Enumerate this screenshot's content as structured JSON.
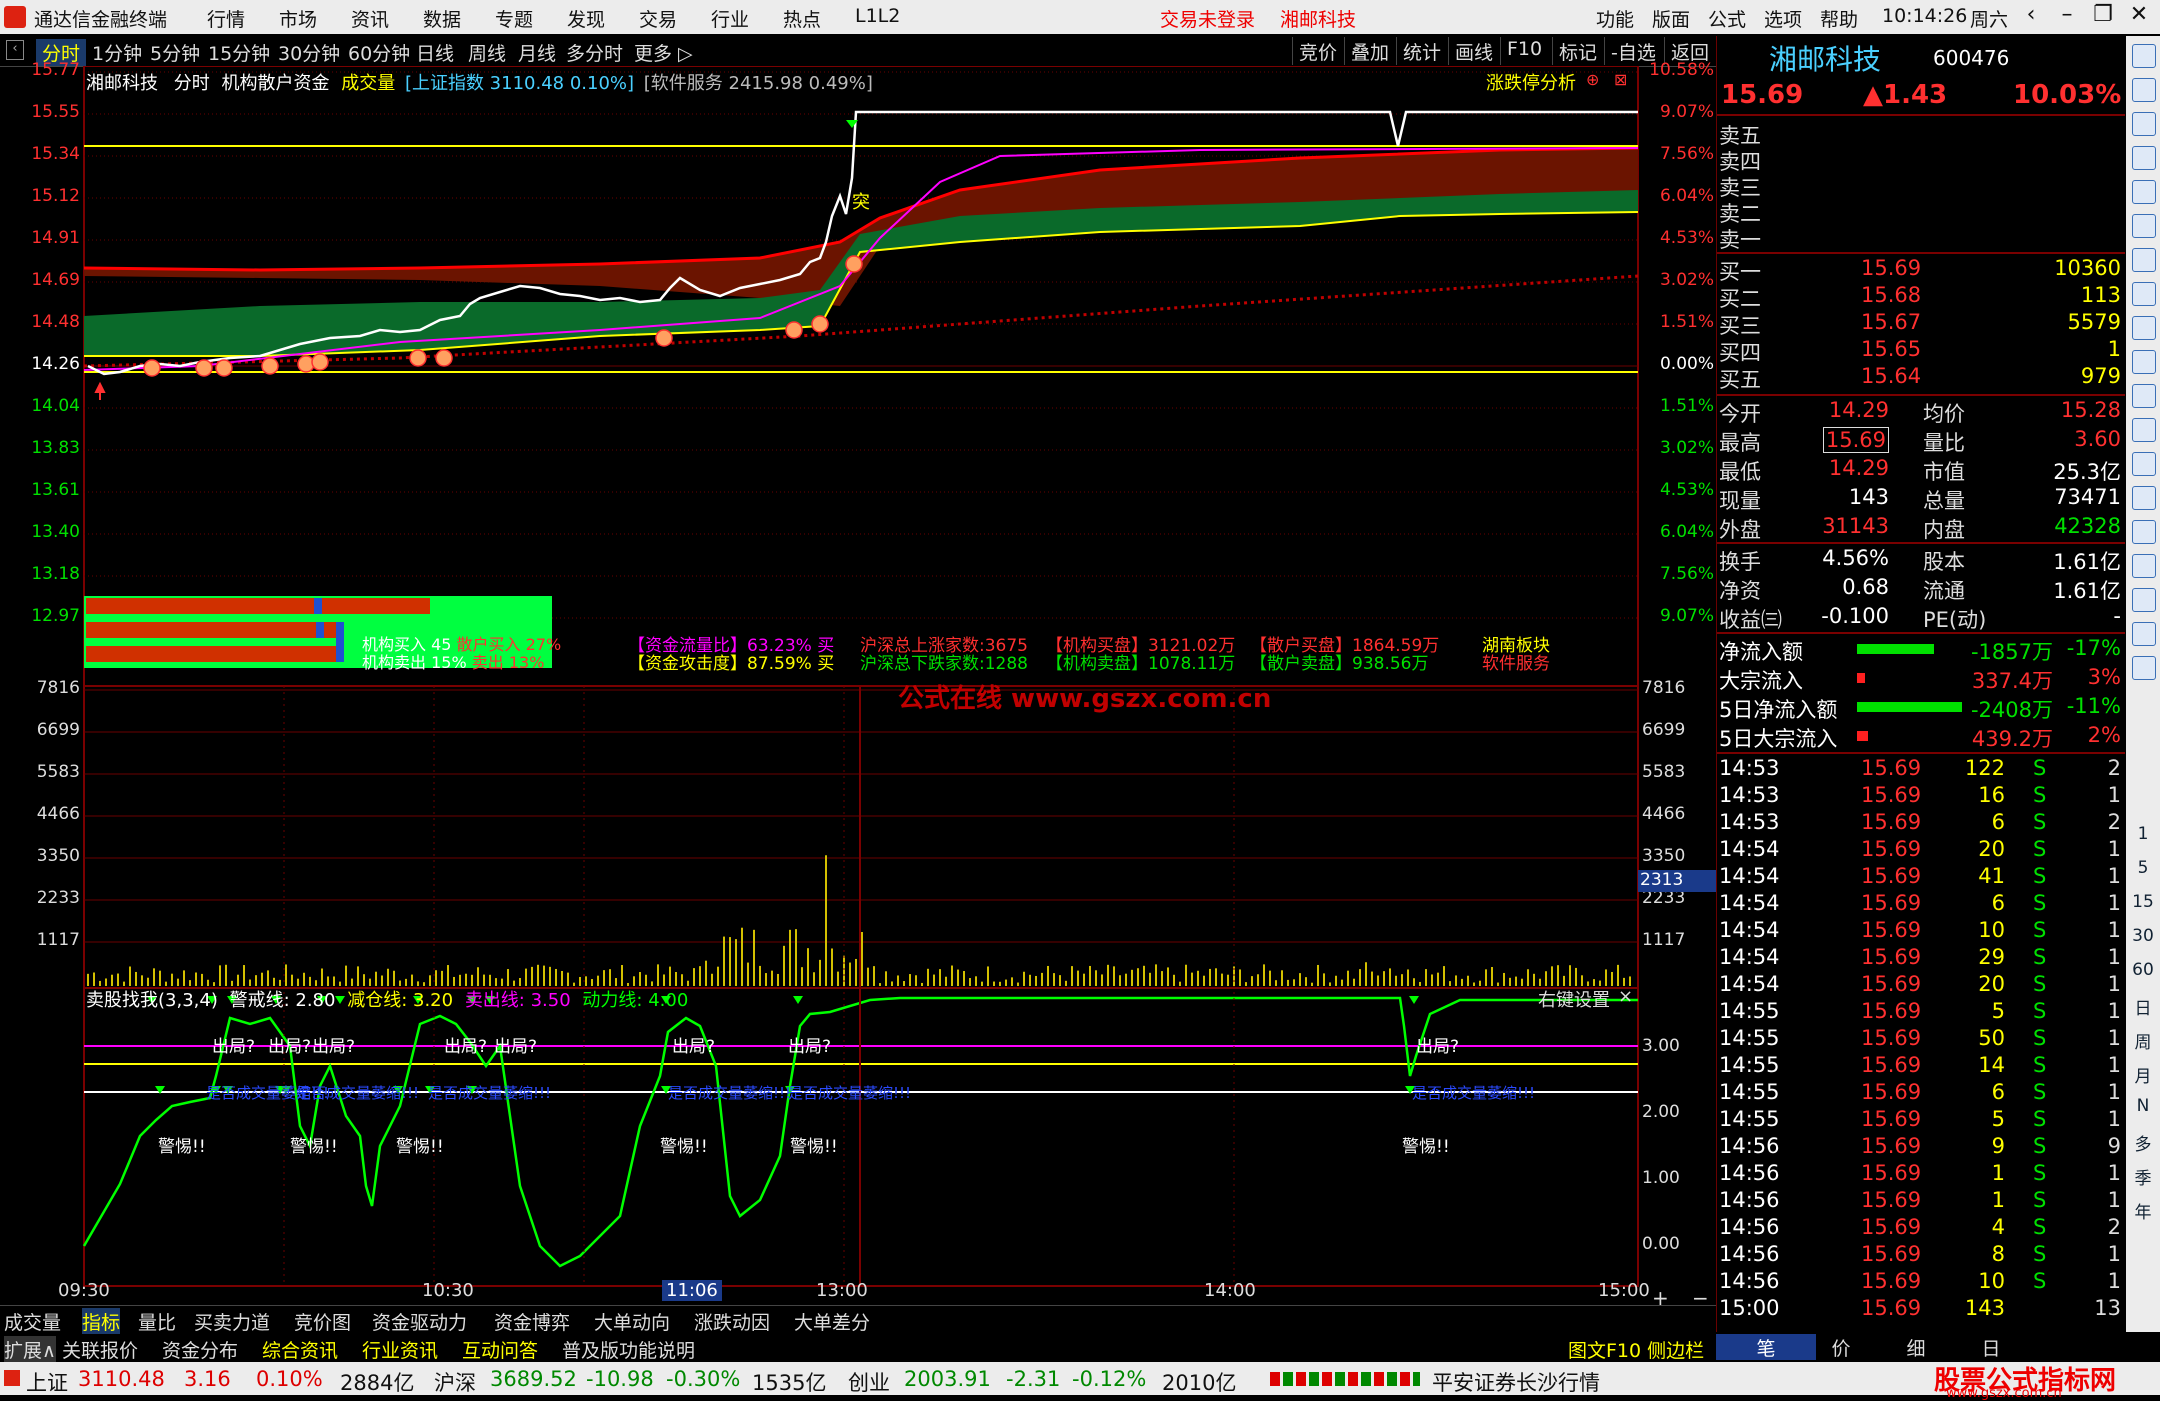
{
  "app": {
    "title": "通达信金融终端",
    "menu": [
      "行情",
      "市场",
      "资讯",
      "数据",
      "专题",
      "发现",
      "交易",
      "行业",
      "热点",
      "L1L2"
    ],
    "login_status": "交易未登录",
    "stock_name_top": "湘邮科技",
    "right_menu": [
      "功能",
      "版面",
      "公式",
      "选项",
      "帮助"
    ],
    "time": "10:14:26",
    "weekday": "周六"
  },
  "periods": {
    "items": [
      "分时",
      "1分钟",
      "5分钟",
      "15分钟",
      "30分钟",
      "60分钟",
      "日线",
      "周线",
      "月线",
      "多分时",
      "更多 ▷"
    ],
    "active": "分时",
    "right_buttons": [
      "竞价",
      "叠加",
      "统计",
      "画线",
      "F10",
      "标记",
      "-自选",
      "返回"
    ]
  },
  "chart_header": {
    "name": "湘邮科技",
    "mode": "分时",
    "indicator": "机构散户资金",
    "vol_label": "成交量",
    "index_text": "[上证指数 3110.48 0.10%]",
    "sector_text": "[软件服务 2415.98 0.49%]",
    "analysis_btn": "涨跌停分析"
  },
  "price_axis_left": [
    "15.77",
    "15.55",
    "15.34",
    "15.12",
    "14.91",
    "14.69",
    "14.48",
    "14.26",
    "14.04",
    "13.83",
    "13.61",
    "13.40",
    "13.18",
    "12.97"
  ],
  "price_axis_right": [
    "10.58%",
    "9.07%",
    "7.56%",
    "6.04%",
    "4.53%",
    "3.02%",
    "1.51%",
    "0.00%",
    "1.51%",
    "3.02%",
    "4.53%",
    "6.04%",
    "7.56%",
    "9.07%"
  ],
  "volume_axis": [
    "7816",
    "6699",
    "5583",
    "4466",
    "3350",
    "2233",
    "1117"
  ],
  "volume_current": "2313",
  "overlay_stats": {
    "inst_buy": "机构买入 45",
    "retail_buy": "散户买入 27%",
    "inst_sell": "机构卖出 15%",
    "retail_sell": "卖出 13%",
    "flow_ratio": "【资金流量比】63.23% 买",
    "attack": "【资金攻击度】87.59% 买",
    "up_count": "沪深总上涨家数:3675",
    "down_count": "沪深总下跌家数:1288",
    "inst_buy_amt": "【机构买盘】3121.02万",
    "inst_sell_amt": "【机构卖盘】1078.11万",
    "retail_buy_amt": "【散户买盘】1864.59万",
    "retail_sell_amt": "【散户卖盘】938.56万",
    "sector1": "湖南板块",
    "sector2": "软件服务"
  },
  "watermark": "公式在线  www.gszx.com.cn",
  "sell_label": "突",
  "indicator_panel": {
    "name": "卖股找我(3,3,4)",
    "warn_line": "警戒线: 2.80",
    "reduce_line": "减仓线: 3.20",
    "sell_line": "卖出线: 3.50",
    "power_line": "动力线: 4.00",
    "settings": "右键设置",
    "axis": [
      "3.00",
      "2.00",
      "1.00",
      "0.00"
    ],
    "exit_text": "出局?",
    "alert_text": "警惕!!",
    "blue_text": "是否成交量萎缩!!!"
  },
  "time_axis": [
    "09:30",
    "10:30",
    "11:06",
    "13:00",
    "14:00",
    "15:00"
  ],
  "tabs_bottom": [
    "成交量",
    "指标",
    "量比",
    "买卖力道",
    "竞价图",
    "资金驱动力",
    "资金博弈",
    "大单动向",
    "涨跌动因",
    "大单差分"
  ],
  "tabs_bottom2": [
    "扩展∧",
    "关联报价",
    "资金分布",
    "综合资讯",
    "行业资讯",
    "互动问答",
    "普及版功能说明"
  ],
  "tabs_bottom2_right": "图文F10 侧边栏 《",
  "right_tabs": [
    "笔",
    "价",
    "细",
    "日"
  ],
  "quote": {
    "name": "湘邮科技",
    "code": "600476",
    "price": "15.69",
    "change": "▲1.43",
    "pct": "10.03%",
    "sells": [
      {
        "label": "卖五",
        "price": "",
        "vol": ""
      },
      {
        "label": "卖四",
        "price": "",
        "vol": ""
      },
      {
        "label": "卖三",
        "price": "",
        "vol": ""
      },
      {
        "label": "卖二",
        "price": "",
        "vol": ""
      },
      {
        "label": "卖一",
        "price": "",
        "vol": ""
      }
    ],
    "buys": [
      {
        "label": "买一",
        "price": "15.69",
        "vol": "10360"
      },
      {
        "label": "买二",
        "price": "15.68",
        "vol": "113"
      },
      {
        "label": "买三",
        "price": "15.67",
        "vol": "5579"
      },
      {
        "label": "买四",
        "price": "15.65",
        "vol": "1"
      },
      {
        "label": "买五",
        "price": "15.64",
        "vol": "979"
      }
    ],
    "stats": [
      {
        "l1": "今开",
        "v1": "14.29",
        "l2": "均价",
        "v2": "15.28"
      },
      {
        "l1": "最高",
        "v1": "15.69",
        "l2": "量比",
        "v2": "3.60"
      },
      {
        "l1": "最低",
        "v1": "14.29",
        "l2": "市值",
        "v2": "25.3亿"
      },
      {
        "l1": "现量",
        "v1": "143",
        "l2": "总量",
        "v2": "73471"
      },
      {
        "l1": "外盘",
        "v1": "31143",
        "l2": "内盘",
        "v2": "42328"
      }
    ],
    "stats2": [
      {
        "l1": "换手",
        "v1": "4.56%",
        "l2": "股本",
        "v2": "1.61亿"
      },
      {
        "l1": "净资",
        "v1": "0.68",
        "l2": "流通",
        "v2": "1.61亿"
      },
      {
        "l1": "收益㈢",
        "v1": "-0.100",
        "l2": "PE(动)",
        "v2": "-"
      }
    ],
    "flows": [
      {
        "label": "净流入额",
        "value": "-1857万",
        "pct": "-17%",
        "bar": 0.55,
        "color": "#00e000"
      },
      {
        "label": "大宗流入",
        "value": "337.4万",
        "pct": "3%",
        "bar": 0.06,
        "color": "#ff2020"
      },
      {
        "label": "5日净流入额",
        "value": "-2408万",
        "pct": "-11%",
        "bar": 0.75,
        "color": "#00e000"
      },
      {
        "label": "5日大宗流入",
        "value": "439.2万",
        "pct": "2%",
        "bar": 0.08,
        "color": "#ff2020"
      }
    ],
    "ticks": [
      [
        "14:53",
        "15.69",
        "122",
        "S",
        "2"
      ],
      [
        "14:53",
        "15.69",
        "16",
        "S",
        "1"
      ],
      [
        "14:53",
        "15.69",
        "6",
        "S",
        "2"
      ],
      [
        "14:54",
        "15.69",
        "20",
        "S",
        "1"
      ],
      [
        "14:54",
        "15.69",
        "41",
        "S",
        "1"
      ],
      [
        "14:54",
        "15.69",
        "6",
        "S",
        "1"
      ],
      [
        "14:54",
        "15.69",
        "10",
        "S",
        "1"
      ],
      [
        "14:54",
        "15.69",
        "29",
        "S",
        "1"
      ],
      [
        "14:54",
        "15.69",
        "20",
        "S",
        "1"
      ],
      [
        "14:55",
        "15.69",
        "5",
        "S",
        "1"
      ],
      [
        "14:55",
        "15.69",
        "50",
        "S",
        "1"
      ],
      [
        "14:55",
        "15.69",
        "14",
        "S",
        "1"
      ],
      [
        "14:55",
        "15.69",
        "6",
        "S",
        "1"
      ],
      [
        "14:55",
        "15.69",
        "5",
        "S",
        "1"
      ],
      [
        "14:56",
        "15.69",
        "9",
        "S",
        "9"
      ],
      [
        "14:56",
        "15.69",
        "1",
        "S",
        "1"
      ],
      [
        "14:56",
        "15.69",
        "1",
        "S",
        "1"
      ],
      [
        "14:56",
        "15.69",
        "4",
        "S",
        "2"
      ],
      [
        "14:56",
        "15.69",
        "8",
        "S",
        "1"
      ],
      [
        "14:56",
        "15.69",
        "10",
        "S",
        "1"
      ],
      [
        "15:00",
        "15.69",
        "143",
        "",
        "13"
      ]
    ]
  },
  "sidebar_text": [
    "1",
    "5",
    "15",
    "30",
    "60",
    "日",
    "周",
    "月",
    "N",
    "多",
    "季",
    "年"
  ],
  "statusbar": {
    "sh_label": "上证",
    "sh_val": "3110.48",
    "sh_chg": "3.16",
    "sh_pct": "0.10%",
    "sh_amt": "2884亿",
    "hs_label": "沪深",
    "hs_val": "3689.52",
    "hs_chg": "-10.98",
    "hs_pct": "-0.30%",
    "hs_amt": "1535亿",
    "cy_label": "创业",
    "cy_val": "2003.91",
    "cy_chg": "-2.31",
    "cy_pct": "-0.12%",
    "cy_amt": "2010亿",
    "broker": "平安证券长沙行情",
    "brand": "股票公式指标网",
    "brand_url": "www.gszx.com.cn"
  },
  "colors": {
    "up": "#ff3030",
    "down": "#00e000",
    "yellow": "#ffff00",
    "grid": "#7a0000",
    "price_line": "#ffffff",
    "avg_line": "#ff00ff"
  }
}
